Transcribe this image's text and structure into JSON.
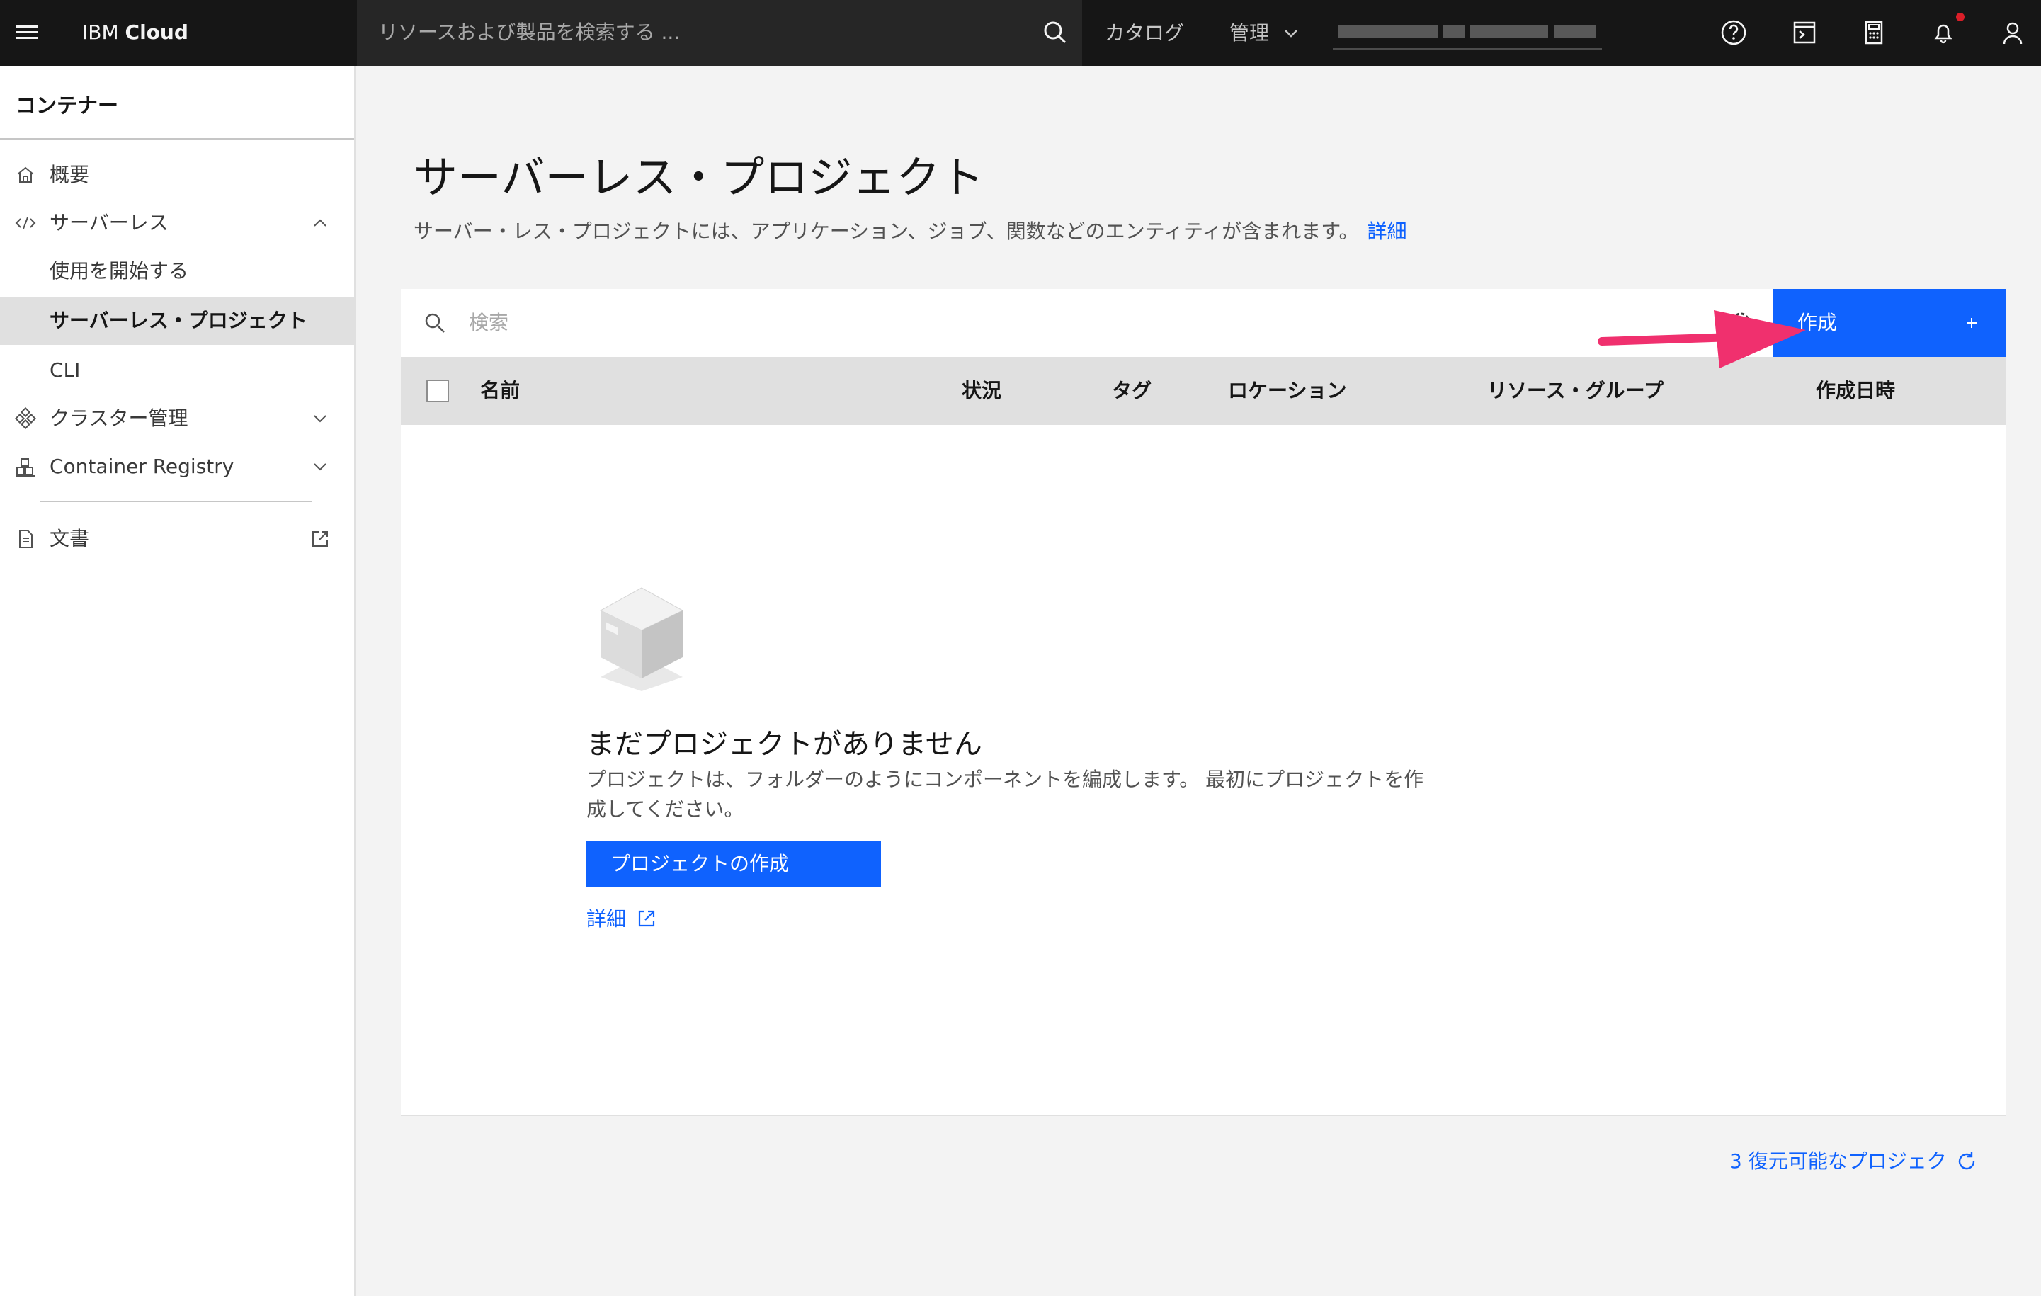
{
  "header": {
    "brand_prefix": "IBM",
    "brand_name": "Cloud",
    "search_placeholder": "リソースおよび製品を検索する ...",
    "catalog_label": "カタログ",
    "manage_label": "管理"
  },
  "sidebar": {
    "title": "コンテナー",
    "items": [
      {
        "label": "概要"
      },
      {
        "label": "サーバーレス"
      },
      {
        "label": "使用を開始する"
      },
      {
        "label": "サーバーレス・プロジェクト"
      },
      {
        "label": "CLI"
      },
      {
        "label": "クラスター管理"
      },
      {
        "label": "Container Registry"
      },
      {
        "label": "文書"
      }
    ],
    "active_item": "サーバーレス・プロジェクト"
  },
  "main": {
    "title": "サーバーレス・プロジェクト",
    "description": "サーバー・レス・プロジェクトには、アプリケーション、ジョブ、関数などのエンティティが含まれます。",
    "details_link": "詳細",
    "search_placeholder": "検索",
    "create_button": "作成",
    "columns": [
      "名前",
      "状況",
      "タグ",
      "ロケーション",
      "リソース・グループ",
      "作成日時"
    ],
    "empty": {
      "title": "まだプロジェクトがありません",
      "description": "プロジェクトは、フォルダーのようにコンポーネントを編成します。 最初にプロジェクトを作成してください。",
      "button": "プロジェクトの作成",
      "link": "詳細"
    },
    "restore_link": "3 復元可能なプロジェク"
  },
  "colors": {
    "accent": "#0f62fe",
    "header_bg": "#161616",
    "annotation_arrow": "#f0306e"
  }
}
